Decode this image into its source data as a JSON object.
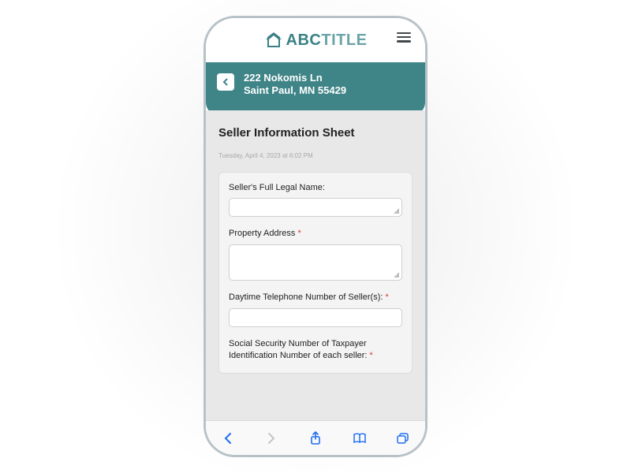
{
  "header": {
    "logo_text_strong": "ABC",
    "logo_text_light": "TITLE"
  },
  "banner": {
    "address_line1": "222 Nokomis Ln",
    "address_line2": "Saint Paul, MN 55429"
  },
  "page": {
    "title": "Seller Information Sheet",
    "timestamp": "Tuesday, April 4, 2023 at 6:02 PM"
  },
  "form": {
    "fields": [
      {
        "label": "Seller's Full Legal Name:",
        "required": false,
        "size": "small"
      },
      {
        "label": "Property Address",
        "required": true,
        "size": "med"
      },
      {
        "label": "Daytime Telephone Number of Seller(s):",
        "required": true,
        "size": "line"
      },
      {
        "label": "Social Security Number of Taxpayer Identification Number of each seller:",
        "required": true,
        "size": "line"
      }
    ]
  }
}
